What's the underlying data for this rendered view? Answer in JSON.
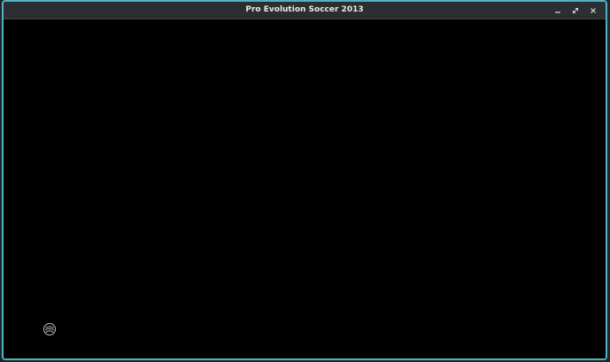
{
  "window": {
    "title": "Pro Evolution Soccer 2013",
    "border_color": "#4fb3c3",
    "titlebar_color": "#2b2f31",
    "controls": [
      {
        "icon": "minimize-icon"
      },
      {
        "icon": "maximize-icon"
      },
      {
        "icon": "close-icon"
      }
    ]
  },
  "content": {
    "background": "#000000",
    "loading_icon": "loading-spinner-icon"
  }
}
